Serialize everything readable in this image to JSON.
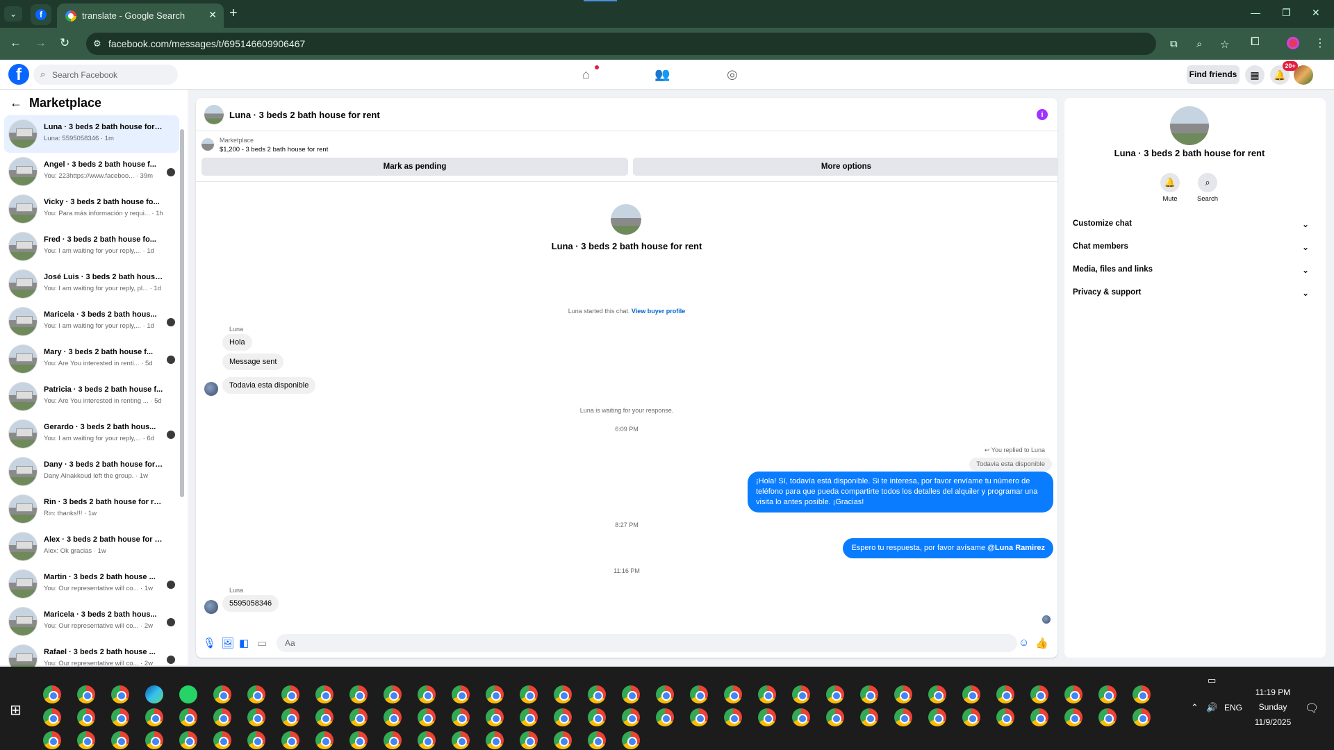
{
  "browser": {
    "tab_title": "translate - Google Search",
    "url": "facebook.com/messages/t/695146609906467"
  },
  "header": {
    "search_placeholder": "Search Facebook",
    "find_friends": "Find friends",
    "notification_count": "20+"
  },
  "sidebar": {
    "title": "Marketplace",
    "conversations": [
      {
        "title": "Luna · 3 beds 2 bath house for r...",
        "subtitle": "Luna: 5595058346 · 1m"
      },
      {
        "title": "Angel · 3 beds 2 bath house f...",
        "subtitle": "You: 223https://www.faceboo... · 39m"
      },
      {
        "title": "Vicky · 3 beds 2 bath house fo...",
        "subtitle": "You: Para más información y requi... · 1h"
      },
      {
        "title": "Fred · 3 beds 2 bath house fo...",
        "subtitle": "You: I am waiting for your reply,... · 1d"
      },
      {
        "title": "José Luis · 3 beds 2 bath house ...",
        "subtitle": "You: I am waiting for your reply, pl... · 1d"
      },
      {
        "title": "Maricela · 3 beds 2 bath hous...",
        "subtitle": "You: I am waiting for your reply,... · 1d"
      },
      {
        "title": "Mary · 3 beds 2 bath house f...",
        "subtitle": "You: Are You interested in renti... · 5d"
      },
      {
        "title": "Patricia · 3 beds 2 bath house f...",
        "subtitle": "You: Are You interested in renting ... · 5d"
      },
      {
        "title": "Gerardo · 3 beds 2 bath hous...",
        "subtitle": "You: I am waiting for your reply,... · 6d"
      },
      {
        "title": "Dany · 3 beds 2 bath house for ...",
        "subtitle": "Dany Alnakkoud left the group. · 1w"
      },
      {
        "title": "Rin · 3 beds 2 bath house for rent",
        "subtitle": "Rin: thanks!!! · 1w"
      },
      {
        "title": "Alex · 3 beds 2 bath house for r...",
        "subtitle": "Alex: Ok gracias · 1w"
      },
      {
        "title": "Martin · 3 beds 2 bath house ...",
        "subtitle": "You: Our representative will co... · 1w"
      },
      {
        "title": "Maricela · 3 beds 2 bath hous...",
        "subtitle": "You: Our representative will co... · 2w"
      },
      {
        "title": "Rafael · 3 beds 2 bath house ...",
        "subtitle": "You: Our representative will co... · 2w"
      }
    ]
  },
  "chat": {
    "title": "Luna · 3 beds 2 bath house for rent",
    "listing_label": "Marketplace",
    "listing_price": "$1,200 - 3 beds 2 bath house for rent",
    "mark_pending": "Mark as pending",
    "more_options": "More options",
    "intro_name": "Luna · 3 beds 2 bath house for rent",
    "started_text": "Luna started this chat.",
    "view_profile": "View buyer profile",
    "sender_name": "Luna",
    "msg_hola": "Hola",
    "msg_sent": "Message sent",
    "msg_disponible": "Todavia esta disponible",
    "waiting_text": "Luna is waiting for your response.",
    "time_1": "6:09 PM",
    "replied_to": "You replied to Luna",
    "quoted_text": "Todavia esta disponible",
    "reply_message": "¡Hola! Sí, todavía está disponible. Si te interesa, por favor envíame tu número de teléfono para que pueda compartirte todos los detalles del alquiler y programar una visita lo antes posible. ¡Gracias!",
    "time_2": "8:27 PM",
    "followup_message": "Espero tu respuesta, por favor avísame",
    "mention": "@Luna Ramirez",
    "time_3": "11:16 PM",
    "sender_name_2": "Luna",
    "phone_message": "5595058346",
    "input_placeholder": "Aa"
  },
  "info_panel": {
    "name": "Luna · 3 beds 2 bath house for rent",
    "mute_label": "Mute",
    "search_label": "Search",
    "rows": [
      "Customize chat",
      "Chat members",
      "Media, files and links",
      "Privacy & support"
    ]
  },
  "taskbar": {
    "time": "11:19 PM",
    "day": "Sunday",
    "date": "11/9/2025",
    "lang": "ENG"
  }
}
